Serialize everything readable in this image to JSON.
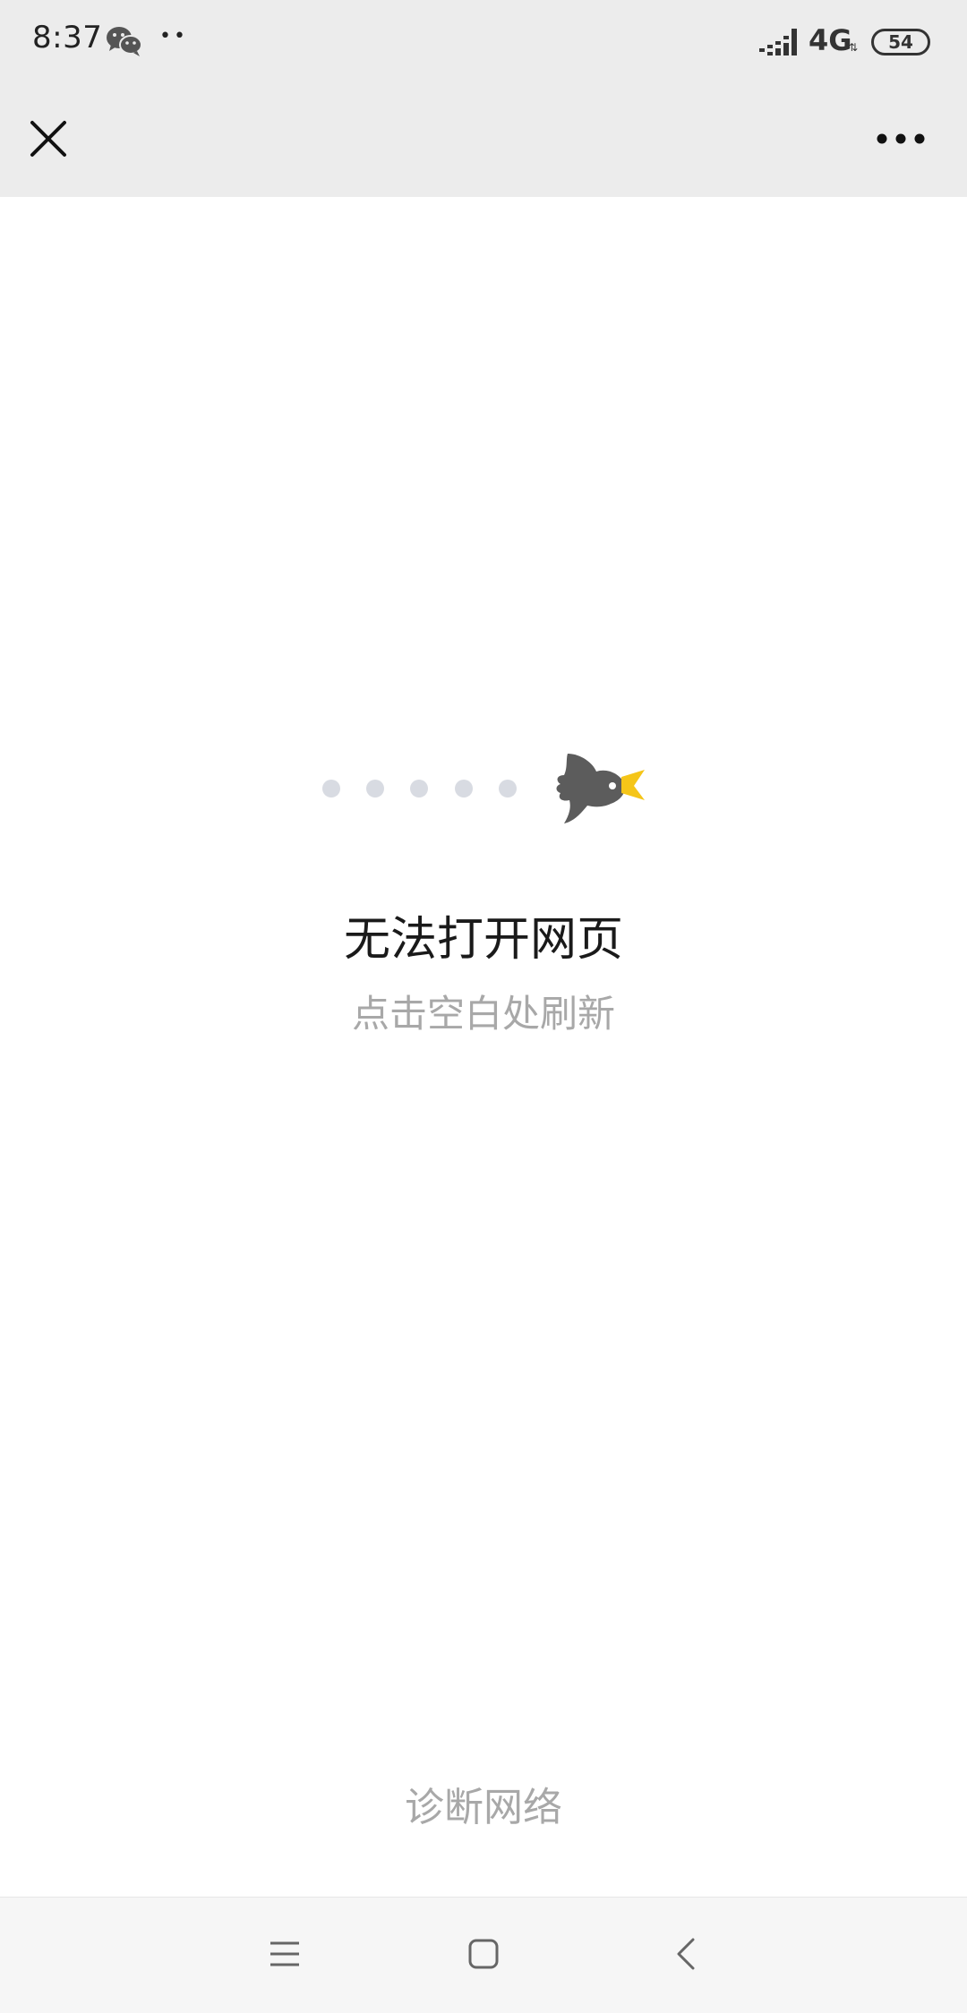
{
  "status_bar": {
    "time": "8:37",
    "app_icon": "wechat-icon",
    "indicator_dots": "••",
    "network": "4G",
    "network_sub": "⇅",
    "battery": "54"
  },
  "top_bar": {
    "close_icon": "close-icon",
    "more_icon": "more-icon"
  },
  "error": {
    "title": "无法打开网页",
    "subtitle": "点击空白处刷新",
    "illustration_icon": "bird-icon",
    "accent_color": "#f5c518"
  },
  "footer": {
    "diagnose_label": "诊断网络"
  },
  "nav_bar": {
    "menu_icon": "menu-icon",
    "home_icon": "home-icon",
    "back_icon": "back-icon"
  }
}
